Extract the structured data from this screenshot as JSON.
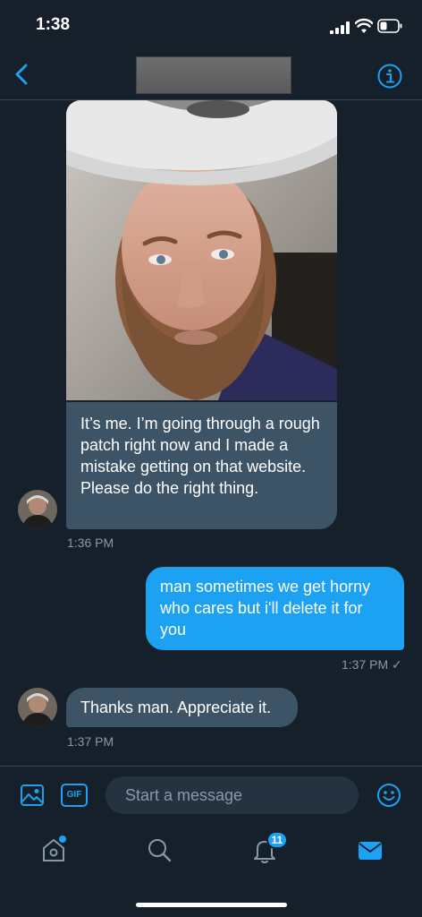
{
  "status_bar": {
    "time": "1:38"
  },
  "header": {
    "back_icon": "chevron-left-icon",
    "info_icon": "info-icon"
  },
  "messages": [
    {
      "direction": "incoming",
      "has_photo": true,
      "text": "It’s me. I’m going through a rough patch right now and I made a mistake getting on that website. Please do the right thing.",
      "time": "1:36 PM"
    },
    {
      "direction": "outgoing",
      "text": "man sometimes we get horny who cares but i'll delete it for you",
      "time": "1:37 PM ✓"
    },
    {
      "direction": "incoming",
      "text": "Thanks man. Appreciate it.",
      "time": "1:37 PM"
    }
  ],
  "composer": {
    "placeholder": "Start a message",
    "gif_label": "GIF"
  },
  "tabbar": {
    "notifications_badge": "11"
  },
  "colors": {
    "background": "#15202b",
    "accent": "#1da1f2",
    "incoming_bubble": "#3d5466",
    "secondary_text": "#8899a6"
  }
}
